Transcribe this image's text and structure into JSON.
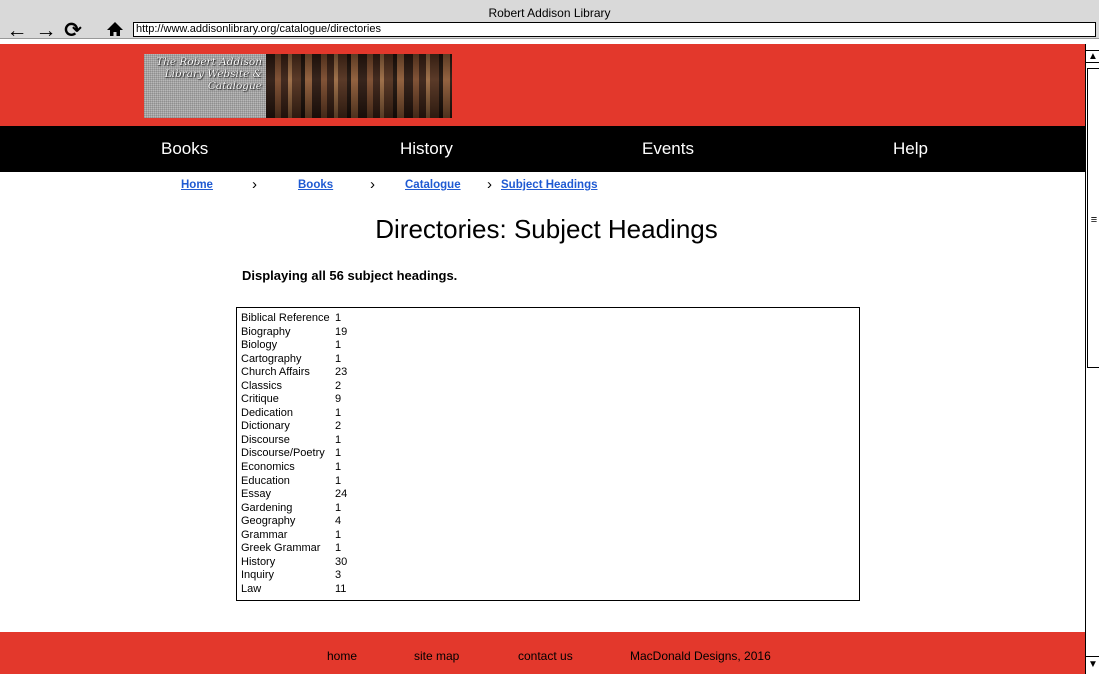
{
  "browser": {
    "window_title": "Robert Addison Library",
    "url": "http://www.addisonlibrary.org/catalogue/directories",
    "back_icon": "back-arrow-icon",
    "forward_icon": "forward-arrow-icon",
    "reload_icon": "reload-icon",
    "home_icon": "home-icon"
  },
  "header": {
    "logo_text": "The Robert Addison Library Website & Catalogue",
    "band_color": "#e3382c"
  },
  "nav": {
    "items": [
      {
        "label": "Books"
      },
      {
        "label": "History"
      },
      {
        "label": "Events"
      },
      {
        "label": "Help"
      }
    ]
  },
  "breadcrumb": [
    {
      "label": "Home"
    },
    {
      "label": "Books"
    },
    {
      "label": "Catalogue"
    },
    {
      "label": "Subject Headings"
    }
  ],
  "main": {
    "title": "Directories: Subject Headings",
    "count_text": "Displaying all 56 subject headings.",
    "headings": [
      {
        "subject": "Biblical Reference",
        "count": "1"
      },
      {
        "subject": "Biography",
        "count": "19"
      },
      {
        "subject": "Biology",
        "count": "1"
      },
      {
        "subject": "Cartography",
        "count": "1"
      },
      {
        "subject": "Church Affairs",
        "count": "23"
      },
      {
        "subject": "Classics",
        "count": "2"
      },
      {
        "subject": "Critique",
        "count": "9"
      },
      {
        "subject": "Dedication",
        "count": "1"
      },
      {
        "subject": "Dictionary",
        "count": "2"
      },
      {
        "subject": "Discourse",
        "count": "1"
      },
      {
        "subject": "Discourse/Poetry",
        "count": "1"
      },
      {
        "subject": "Economics",
        "count": "1"
      },
      {
        "subject": "Education",
        "count": "1"
      },
      {
        "subject": "Essay",
        "count": "24"
      },
      {
        "subject": "Gardening",
        "count": "1"
      },
      {
        "subject": "Geography",
        "count": "4"
      },
      {
        "subject": "Grammar",
        "count": "1"
      },
      {
        "subject": "Greek Grammar",
        "count": "1"
      },
      {
        "subject": "History",
        "count": "30"
      },
      {
        "subject": "Inquiry",
        "count": "3"
      },
      {
        "subject": "Law",
        "count": "11"
      }
    ]
  },
  "footer": {
    "links": [
      {
        "label": "home"
      },
      {
        "label": "site map"
      },
      {
        "label": "contact us"
      }
    ],
    "credit": "MacDonald Designs, 2016"
  }
}
